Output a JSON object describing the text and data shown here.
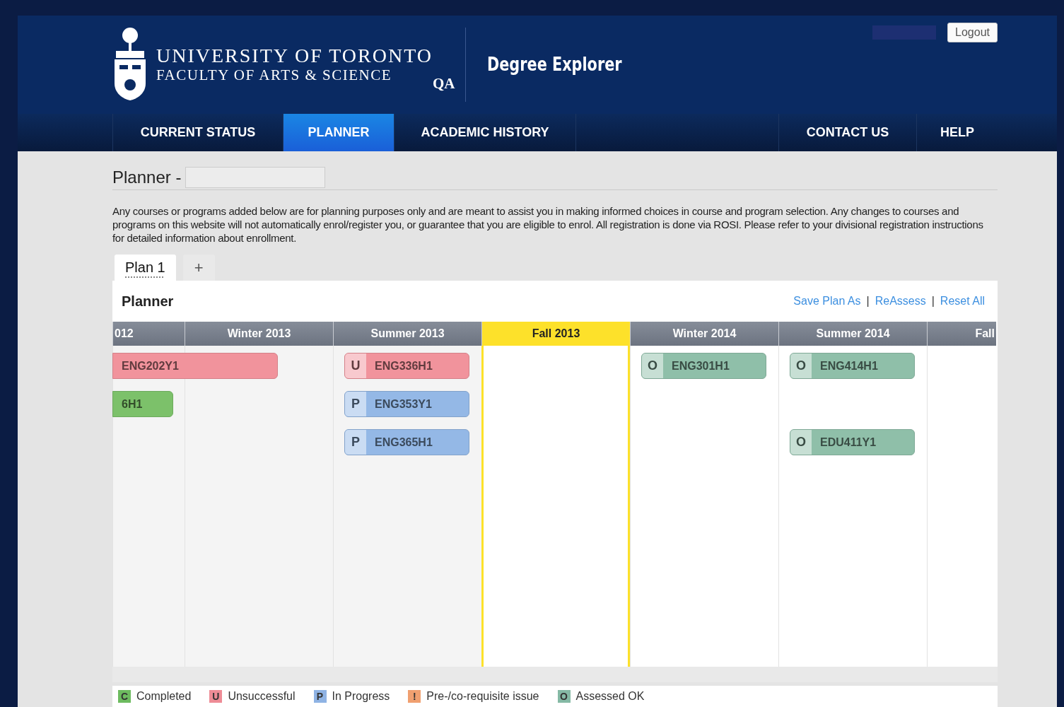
{
  "header": {
    "university": "UNIVERSITY OF TORONTO",
    "faculty": "FACULTY OF ARTS & SCIENCE",
    "environment": "QA",
    "app_title": "Degree Explorer",
    "logout": "Logout"
  },
  "nav": [
    {
      "label": "CURRENT STATUS",
      "selected": false
    },
    {
      "label": "PLANNER",
      "selected": true
    },
    {
      "label": "ACADEMIC HISTORY",
      "selected": false
    },
    {
      "label": "CONTACT US",
      "selected": false
    },
    {
      "label": "HELP",
      "selected": false
    }
  ],
  "page": {
    "title": "Planner -",
    "notice": "Any courses or programs added below are for planning purposes only and are meant to assist you in making informed choices in course and program selection. Any changes to courses and programs on this website will not automatically enrol/register you, or guarantee that you are eligible to enrol. All registration is done via ROSI. Please refer to your divisional registration instructions for detailed information about enrollment."
  },
  "plan_tabs": [
    {
      "label": "Plan 1",
      "kind": "plan",
      "selected": true
    },
    {
      "label": "+",
      "kind": "add",
      "selected": false
    }
  ],
  "planner": {
    "title": "Planner",
    "links": [
      {
        "kind": "link",
        "label": "Save Plan As"
      },
      {
        "kind": "separator",
        "label": "|"
      },
      {
        "kind": "link",
        "label": "ReAssess"
      },
      {
        "kind": "separator",
        "label": "|"
      },
      {
        "kind": "link",
        "label": "Reset All"
      }
    ],
    "terms": [
      {
        "label": "012",
        "past": true,
        "current": false,
        "courses": [
          {
            "code": "ENG202Y1",
            "color": "#f1939c",
            "kind": "full_year"
          },
          {
            "code": "6H1",
            "color": "#7cc16a",
            "kind": "half"
          }
        ]
      },
      {
        "label": "Winter 2013",
        "past": true,
        "current": false
      },
      {
        "label": "Summer 2013",
        "past": true,
        "current": false,
        "courses": [
          {
            "code": "ENG336H1",
            "color": "#f1939c",
            "badge": "U",
            "kind": "half"
          },
          {
            "code": "ENG353Y1",
            "color": "#94b8e6",
            "badge": "P",
            "kind": "half"
          },
          {
            "code": "ENG365H1",
            "color": "#94b8e6",
            "badge": "P",
            "kind": "half"
          }
        ]
      },
      {
        "label": "Fall 2013",
        "past": false,
        "current": true
      },
      {
        "label": "Winter 2014",
        "past": false,
        "current": false,
        "courses": [
          {
            "code": "ENG301H1",
            "color": "#8fbfa9",
            "badge": "O",
            "kind": "half"
          }
        ]
      },
      {
        "label": "Summer 2014",
        "past": false,
        "current": false,
        "courses": [
          {
            "code": "ENG414H1",
            "color": "#8fbfa9",
            "badge": "O",
            "kind": "half"
          },
          {
            "code": "EDU411Y1",
            "color": "#8fbfa9",
            "badge": "O",
            "kind": "half"
          }
        ]
      },
      {
        "label": "Fall",
        "past": false,
        "current": false
      }
    ]
  },
  "legend": [
    {
      "letter": "C",
      "label": "Completed",
      "color": "#6dbb5f"
    },
    {
      "letter": "U",
      "label": "Unsuccessful",
      "color": "#ee8c96"
    },
    {
      "letter": "P",
      "label": "In Progress",
      "color": "#8fb3e4"
    },
    {
      "letter": "!",
      "label": "Pre-/co-requisite issue",
      "color": "#f0a070"
    },
    {
      "letter": "O",
      "label": "Assessed OK",
      "color": "#85b9a5"
    }
  ]
}
